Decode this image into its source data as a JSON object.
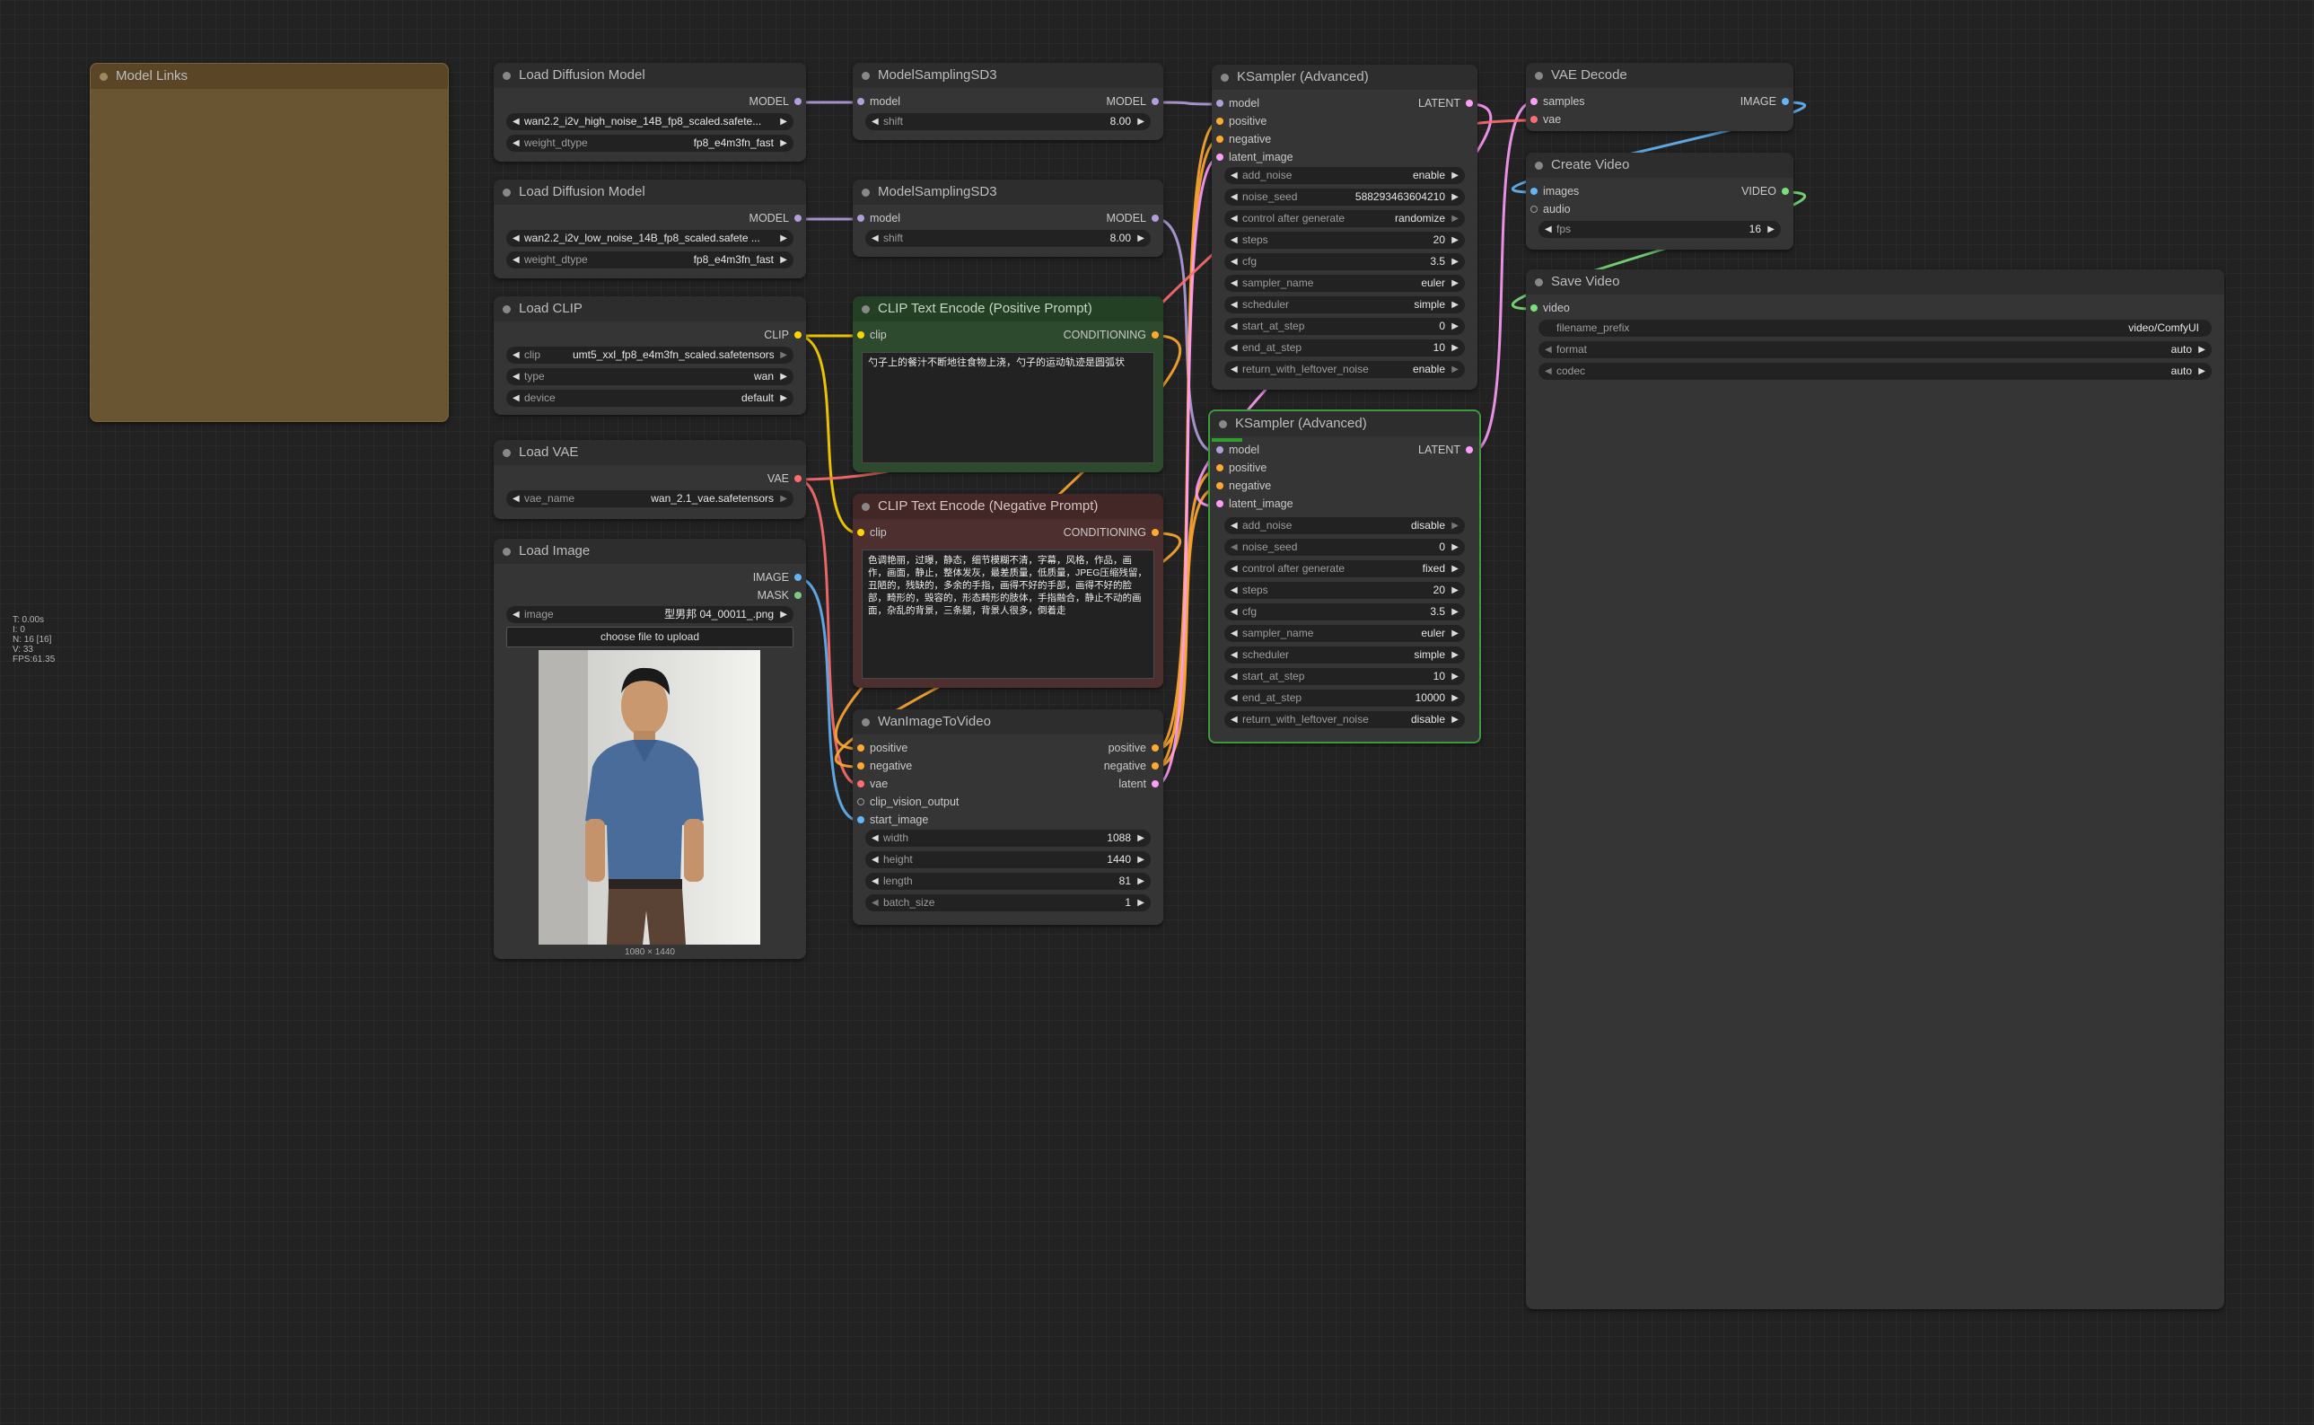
{
  "stats": [
    "T: 0.00s",
    "I: 0",
    "N: 16 [16]",
    "V: 33",
    "FPS:61.35"
  ],
  "colors": {
    "model": "#b39ddb",
    "clip": "#ffd500",
    "vae": "#ff6e6e",
    "conditioning": "#ffa931",
    "latent": "#ff9cf9",
    "image": "#64b5f6",
    "mask": "#81c784",
    "video": "#7be07b"
  },
  "nodes": {
    "model_links": {
      "title": "Model Links"
    },
    "load_diffusion_1": {
      "title": "Load Diffusion Model",
      "out_model": "MODEL",
      "unet_name": "wan2.2_i2v_high_noise_14B_fp8_scaled.safete...",
      "weight_dtype_label": "weight_dtype",
      "weight_dtype": "fp8_e4m3fn_fast"
    },
    "load_diffusion_2": {
      "title": "Load Diffusion Model",
      "out_model": "MODEL",
      "unet_name": "wan2.2_i2v_low_noise_14B_fp8_scaled.safete ...",
      "weight_dtype_label": "weight_dtype",
      "weight_dtype": "fp8_e4m3fn_fast"
    },
    "load_clip": {
      "title": "Load CLIP",
      "out_clip": "CLIP",
      "clip_label": "clip",
      "clip_name": "umt5_xxl_fp8_e4m3fn_scaled.safetensors",
      "type_label": "type",
      "type": "wan",
      "device_label": "device",
      "device": "default"
    },
    "load_vae": {
      "title": "Load VAE",
      "out_vae": "VAE",
      "vae_name_label": "vae_name",
      "vae_name": "wan_2.1_vae.safetensors"
    },
    "load_image": {
      "title": "Load Image",
      "out_image": "IMAGE",
      "out_mask": "MASK",
      "image_label": "image",
      "image": "型男邦 04_00011_.png",
      "upload": "choose file to upload",
      "dims": "1080 × 1440"
    },
    "msd3_1": {
      "title": "ModelSamplingSD3",
      "in_model": "model",
      "out_model": "MODEL",
      "shift_label": "shift",
      "shift": "8.00"
    },
    "msd3_2": {
      "title": "ModelSamplingSD3",
      "in_model": "model",
      "out_model": "MODEL",
      "shift_label": "shift",
      "shift": "8.00"
    },
    "clip_pos": {
      "title": "CLIP Text Encode (Positive Prompt)",
      "in_clip": "clip",
      "out_cond": "CONDITIONING",
      "text": "勺子上的餐汁不断地往食物上浇，勺子的运动轨迹是圆弧状"
    },
    "clip_neg": {
      "title": "CLIP Text Encode (Negative Prompt)",
      "in_clip": "clip",
      "out_cond": "CONDITIONING",
      "text": "色调艳丽，过曝，静态，细节模糊不清，字幕，风格，作品，画作，画面，静止，整体发灰，最差质量，低质量，JPEG压缩残留，丑陋的，残缺的，多余的手指，画得不好的手部，画得不好的脸部，畸形的，毁容的，形态畸形的肢体，手指融合，静止不动的画面，杂乱的背景，三条腿，背景人很多，倒着走"
    },
    "wan_i2v": {
      "title": "WanImageToVideo",
      "inputs": [
        "positive",
        "negative",
        "vae",
        "clip_vision_output",
        "start_image"
      ],
      "outputs": [
        "positive",
        "negative",
        "latent"
      ],
      "widgets": [
        {
          "label": "width",
          "value": "1088"
        },
        {
          "label": "height",
          "value": "1440"
        },
        {
          "label": "length",
          "value": "81"
        },
        {
          "label": "batch_size",
          "value": "1"
        }
      ]
    },
    "ksampler_1": {
      "title": "KSampler (Advanced)",
      "inputs": [
        "model",
        "positive",
        "negative",
        "latent_image"
      ],
      "out_latent": "LATENT",
      "widgets": [
        {
          "label": "add_noise",
          "value": "enable"
        },
        {
          "label": "noise_seed",
          "value": "588293463604210"
        },
        {
          "label": "control after generate",
          "value": "randomize"
        },
        {
          "label": "steps",
          "value": "20"
        },
        {
          "label": "cfg",
          "value": "3.5"
        },
        {
          "label": "sampler_name",
          "value": "euler"
        },
        {
          "label": "scheduler",
          "value": "simple"
        },
        {
          "label": "start_at_step",
          "value": "0"
        },
        {
          "label": "end_at_step",
          "value": "10"
        },
        {
          "label": "return_with_leftover_noise",
          "value": "enable"
        }
      ]
    },
    "ksampler_2": {
      "title": "KSampler (Advanced)",
      "inputs": [
        "model",
        "positive",
        "negative",
        "latent_image"
      ],
      "out_latent": "LATENT",
      "widgets": [
        {
          "label": "add_noise",
          "value": "disable"
        },
        {
          "label": "noise_seed",
          "value": "0"
        },
        {
          "label": "control after generate",
          "value": "fixed"
        },
        {
          "label": "steps",
          "value": "20"
        },
        {
          "label": "cfg",
          "value": "3.5"
        },
        {
          "label": "sampler_name",
          "value": "euler"
        },
        {
          "label": "scheduler",
          "value": "simple"
        },
        {
          "label": "start_at_step",
          "value": "10"
        },
        {
          "label": "end_at_step",
          "value": "10000"
        },
        {
          "label": "return_with_leftover_noise",
          "value": "disable"
        }
      ]
    },
    "vae_decode": {
      "title": "VAE Decode",
      "in_samples": "samples",
      "in_vae": "vae",
      "out_image": "IMAGE"
    },
    "create_video": {
      "title": "Create Video",
      "in_images": "images",
      "in_audio": "audio",
      "out_video": "VIDEO",
      "fps_label": "fps",
      "fps": "16"
    },
    "save_video": {
      "title": "Save Video",
      "in_video": "video",
      "filename_prefix_label": "filename_prefix",
      "filename_prefix": "video/ComfyUI",
      "format_label": "format",
      "format": "auto",
      "codec_label": "codec",
      "codec": "auto"
    }
  }
}
